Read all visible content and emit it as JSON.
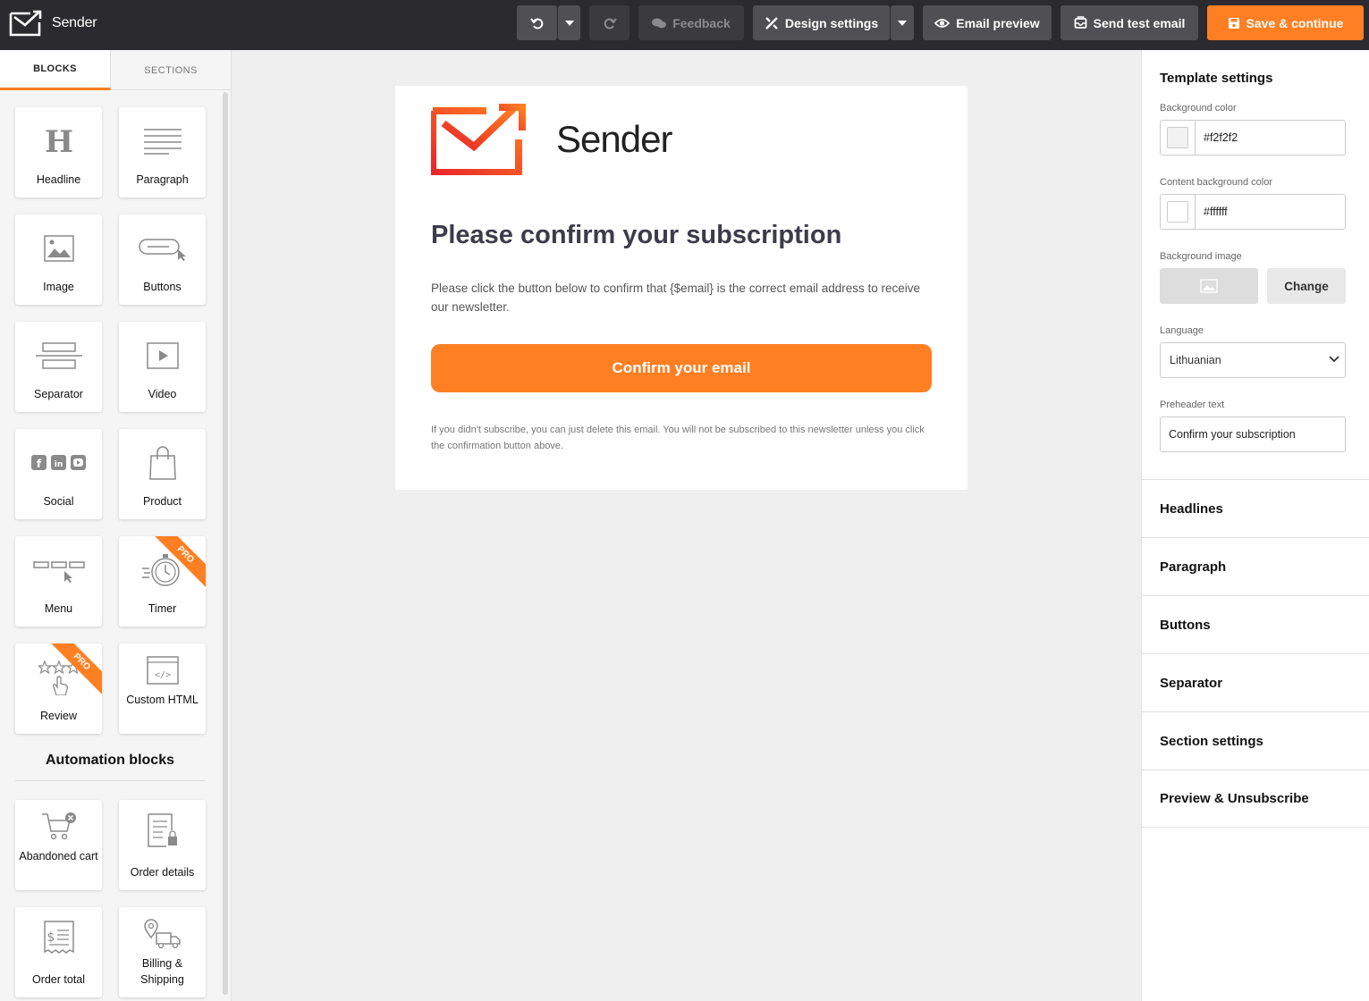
{
  "app": {
    "logo_text": "Sender"
  },
  "toolbar": {
    "feedback": "Feedback",
    "design_settings": "Design settings",
    "email_preview": "Email preview",
    "send_test": "Send test email",
    "save": "Save & continue"
  },
  "left_panel": {
    "tabs": [
      "BLOCKS",
      "SECTIONS"
    ],
    "blocks": [
      {
        "label": "Headline",
        "icon": "headline-icon"
      },
      {
        "label": "Paragraph",
        "icon": "paragraph-icon"
      },
      {
        "label": "Image",
        "icon": "image-icon"
      },
      {
        "label": "Buttons",
        "icon": "button-icon"
      },
      {
        "label": "Separator",
        "icon": "separator-icon"
      },
      {
        "label": "Video",
        "icon": "video-icon"
      },
      {
        "label": "Social",
        "icon": "social-icon"
      },
      {
        "label": "Product",
        "icon": "shopping-bag-icon"
      },
      {
        "label": "Menu",
        "icon": "menu-icon"
      },
      {
        "label": "Timer",
        "icon": "stopwatch-icon",
        "badge": "PRO"
      },
      {
        "label": "Review",
        "icon": "stars-icon",
        "badge": "PRO"
      },
      {
        "label": "Custom HTML",
        "icon": "code-icon"
      }
    ],
    "automation_title": "Automation blocks",
    "automation_blocks": [
      {
        "label": "Abandoned cart",
        "icon": "cart-icon"
      },
      {
        "label": "Order details",
        "icon": "order-document-icon"
      },
      {
        "label": "Order total",
        "icon": "receipt-icon"
      },
      {
        "label": "Billing & Shipping",
        "icon": "delivery-truck-icon"
      }
    ]
  },
  "email": {
    "logo_text": "Sender",
    "title": "Please confirm your subscription",
    "paragraph": "Please click the button below to confirm that {$email} is the correct email address to receive our newsletter.",
    "button": "Confirm your email",
    "footer": "If you didn't subscribe, you can just delete this email. You will not be subscribed to this newsletter unless you click the confirmation button above."
  },
  "right_panel": {
    "title": "Template settings",
    "background_color_label": "Background color",
    "background_color": "#f2f2f2",
    "content_bg_label": "Content background color",
    "content_bg": "#ffffff",
    "bg_image_label": "Background image",
    "change": "Change",
    "language_label": "Language",
    "language": "Lithuanian",
    "preheader_label": "Preheader text",
    "preheader": "Confirm your subscription",
    "sections": [
      "Headlines",
      "Paragraph",
      "Buttons",
      "Separator",
      "Section settings",
      "Preview & Unsubscribe"
    ]
  },
  "colors": {
    "accent": "#ff7f22",
    "topbar": "#2b2b2f"
  }
}
